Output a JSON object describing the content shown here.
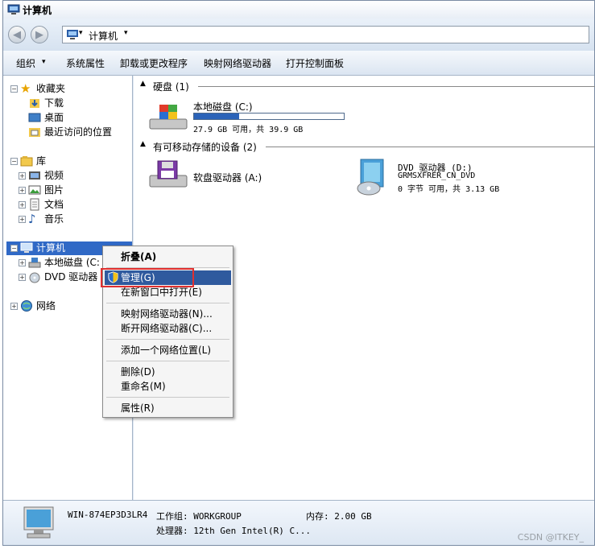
{
  "window": {
    "title": "计算机"
  },
  "address": {
    "crumb": "计算机",
    "arrow": "▾",
    "dropdown": "▾"
  },
  "toolbar": {
    "items": [
      "组织",
      "系统属性",
      "卸载或更改程序",
      "映射网络驱动器",
      "打开控制面板"
    ],
    "organize_arrow": "▾"
  },
  "nav": {
    "favorites": "收藏夹",
    "favorites_items": [
      "下载",
      "桌面",
      "最近访问的位置"
    ],
    "library": "库",
    "library_items": [
      "视频",
      "图片",
      "文档",
      "音乐"
    ],
    "computer": "计算机",
    "computer_items": [
      "本地磁盘 (C:",
      "DVD 驱动器"
    ],
    "network": "网络"
  },
  "content": {
    "hdd_group": "硬盘 (1)",
    "local_disk": {
      "name": "本地磁盘 (C:)",
      "info": "27.9 GB 可用，共 39.9 GB",
      "used_fraction": 0.3
    },
    "removable_group": "有可移动存储的设备 (2)",
    "floppy": {
      "name": "软盘驱动器 (A:)"
    },
    "dvd": {
      "name": "DVD 驱动器 (D:)",
      "label": "GRMSXFRER_CN_DVD",
      "info": "0 字节 可用，共 3.13 GB"
    }
  },
  "context_menu": {
    "collapse": "折叠(A)",
    "manage": "管理(G)",
    "open_new": "在新窗口中打开(E)",
    "map_drive": "映射网络驱动器(N)...",
    "disconnect": "断开网络驱动器(C)...",
    "add_location": "添加一个网络位置(L)",
    "delete": "删除(D)",
    "rename": "重命名(M)",
    "properties": "属性(R)"
  },
  "details": {
    "computer_name": "WIN-874EP3D3LR4",
    "workgroup": "工作组: WORKGROUP",
    "memory": "内存: 2.00 GB",
    "processor": "处理器: 12th Gen Intel(R) C..."
  },
  "watermark": "CSDN @ITKEY_"
}
